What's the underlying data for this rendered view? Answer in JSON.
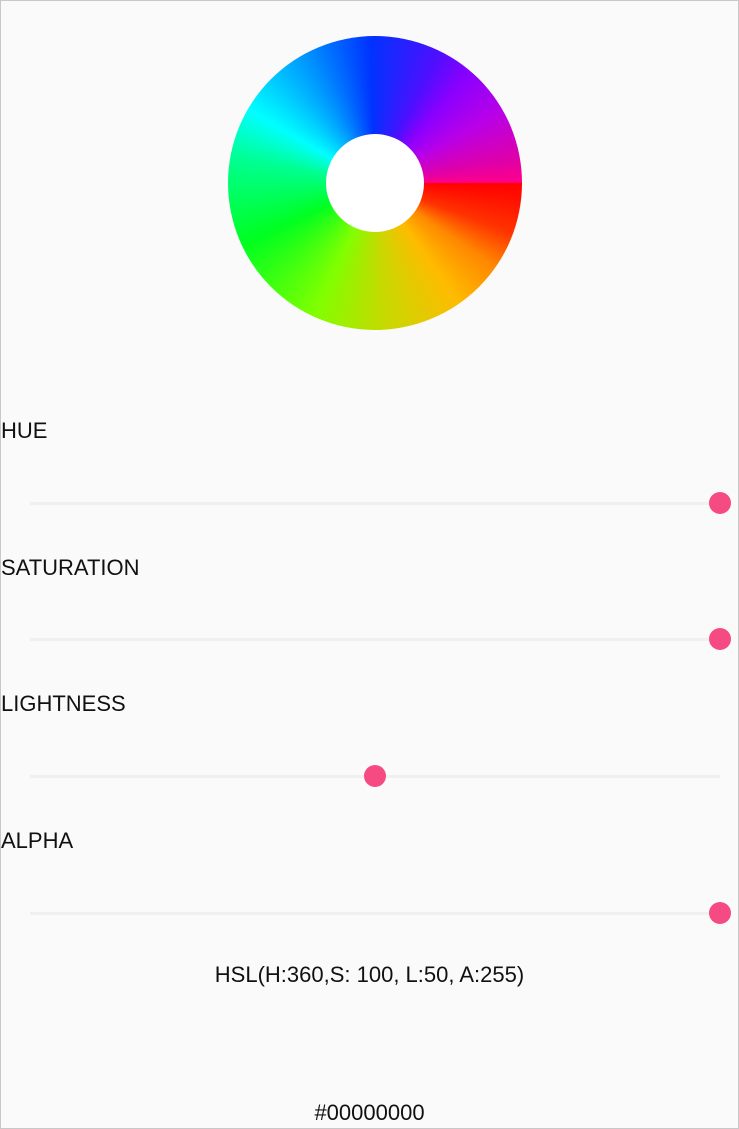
{
  "sliders": [
    {
      "label": "HUE",
      "value": 360,
      "max": 360
    },
    {
      "label": "SATURATION",
      "value": 100,
      "max": 100
    },
    {
      "label": "LIGHTNESS",
      "value": 50,
      "max": 100
    },
    {
      "label": "ALPHA",
      "value": 255,
      "max": 255
    }
  ],
  "accent_color": "#f64a83",
  "hsl_readout": "HSL(H:360,S: 100, L:50, A:255)",
  "hex_readout": "#00000000"
}
